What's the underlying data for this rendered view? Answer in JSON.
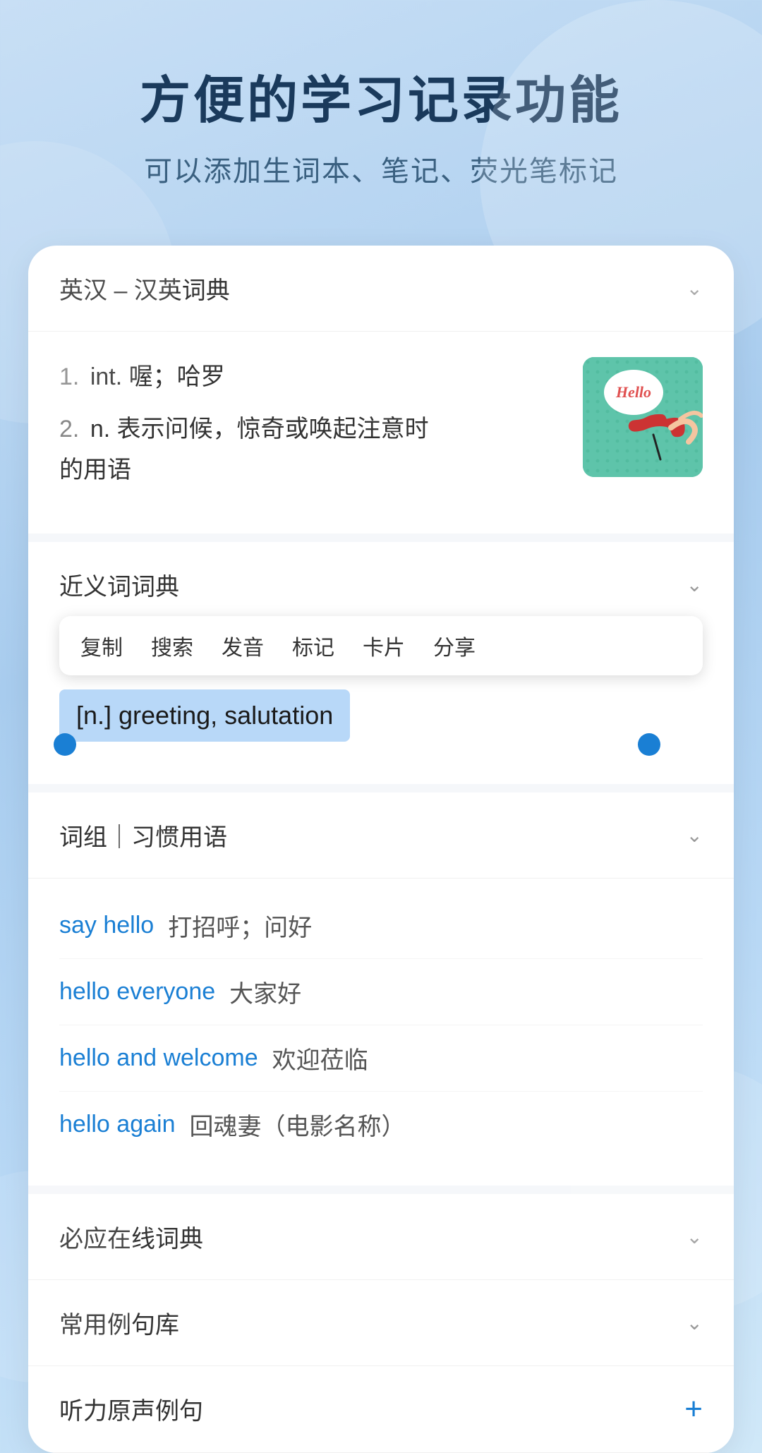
{
  "header": {
    "main_title": "方便的学习记录功能",
    "sub_title": "可以添加生词本、笔记、荧光笔标记"
  },
  "dict_section": {
    "title": "英汉 – 汉英词典",
    "definitions": [
      {
        "num": "1.",
        "pos": "int.",
        "text": "喔；哈罗"
      },
      {
        "num": "2.",
        "pos": "n.",
        "text": "表示问候，惊奇或唤起注意时的用语"
      }
    ]
  },
  "synonym_section": {
    "title": "近义词词典",
    "context_menu": [
      "复制",
      "搜索",
      "发音",
      "标记",
      "卡片",
      "分享"
    ],
    "selected_text": "[n.] greeting, salutation"
  },
  "phrases_section": {
    "title": "词组｜习惯用语",
    "phrases": [
      {
        "en": "say hello",
        "zh": "打招呼；问好"
      },
      {
        "en": "hello everyone",
        "zh": "大家好"
      },
      {
        "en": "hello and welcome",
        "zh": "欢迎莅临"
      },
      {
        "en": "hello again",
        "zh": "回魂妻（电影名称）"
      }
    ]
  },
  "bottom_sections": [
    {
      "title": "必应在线词典",
      "icon": "chevron-down"
    },
    {
      "title": "常用例句库",
      "icon": "chevron-down"
    },
    {
      "title": "听力原声例句",
      "icon": "plus"
    }
  ],
  "icons": {
    "chevron_up": "∧",
    "chevron_down": "∨",
    "plus": "+"
  }
}
